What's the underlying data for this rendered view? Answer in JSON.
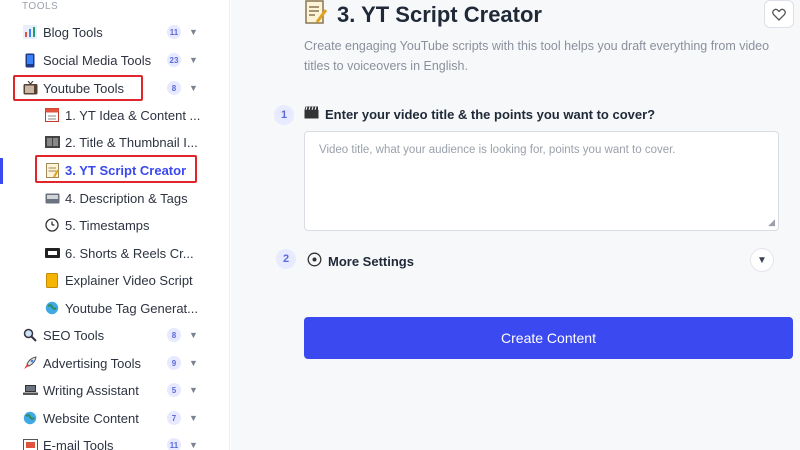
{
  "sidebar": {
    "section_title": "TOOLS",
    "categories": [
      {
        "label": "Blog Tools",
        "count": "11",
        "icon": "bar-chart-icon"
      },
      {
        "label": "Social Media Tools",
        "count": "23",
        "icon": "phone-icon"
      },
      {
        "label": "Youtube Tools",
        "count": "8",
        "icon": "tv-icon"
      }
    ],
    "youtube_items": [
      "1. YT Idea & Content ...",
      "2. Title & Thumbnail I...",
      "3. YT Script Creator",
      "4. Description & Tags",
      "5. Timestamps",
      "6. Shorts & Reels Cr...",
      "Explainer Video Script",
      "Youtube Tag Generat..."
    ],
    "more_categories": [
      {
        "label": "SEO Tools",
        "count": "8",
        "icon": "magnifier-icon"
      },
      {
        "label": "Advertising Tools",
        "count": "9",
        "icon": "rocket-icon"
      },
      {
        "label": "Writing Assistant",
        "count": "5",
        "icon": "laptop-icon"
      },
      {
        "label": "Website Content",
        "count": "7",
        "icon": "globe-icon"
      },
      {
        "label": "E-mail Tools",
        "count": "11",
        "icon": "envelope-icon"
      }
    ]
  },
  "main": {
    "title": "3. YT Script Creator",
    "description": "Create engaging YouTube scripts with this tool helps you draft everything from video titles to voiceovers in English.",
    "step1": {
      "number": "1",
      "label": "Enter your video title & the points you want to cover?",
      "placeholder": "Video title, what your audience is looking for, points you want to cover."
    },
    "step2": {
      "number": "2",
      "label": "More Settings"
    },
    "cta_label": "Create Content"
  },
  "colors": {
    "accent": "#3b49f0",
    "highlight": "#e0262b"
  }
}
